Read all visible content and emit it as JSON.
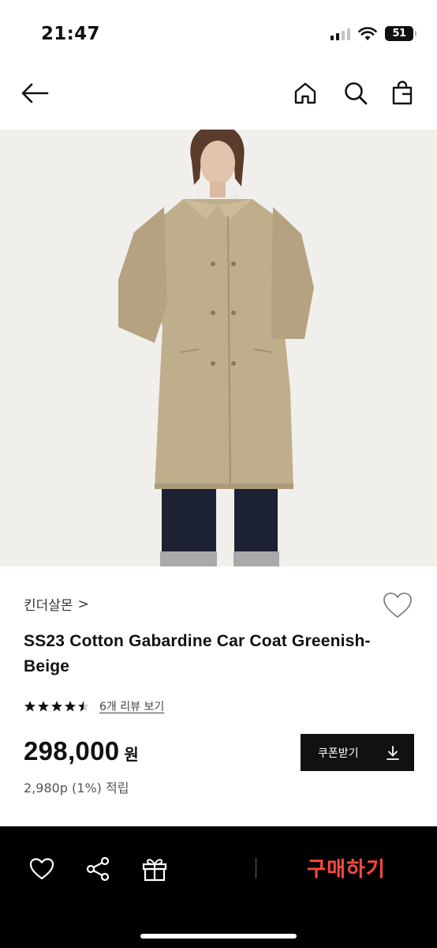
{
  "status_bar": {
    "time": "21:47",
    "battery": "51",
    "icons": [
      "signal-icon",
      "wifi-icon",
      "battery-icon"
    ]
  },
  "nav": {
    "icons": [
      "back-arrow-icon",
      "home-icon",
      "search-icon",
      "shopping-bag-icon"
    ]
  },
  "product": {
    "brand": "킨더살몬",
    "brand_chevron": ">",
    "title": "SS23 Cotton Gabardine Car Coat Greenish-Beige",
    "rating": 4.5,
    "review_link": "6개 리뷰 보기",
    "price": "298,000",
    "currency": "원",
    "points": "2,980p (1%) 적립"
  },
  "coupon": {
    "label": "쿠폰받기",
    "icon": "download-icon"
  },
  "bottom_bar": {
    "icons": [
      "heart-icon",
      "share-icon",
      "gift-icon"
    ],
    "buy_label": "구매하기"
  },
  "colors": {
    "buy_accent": "#ff4a3d",
    "bottom_bar_bg": "#000000",
    "coat": "#bfae8c",
    "background": "#f1efeb"
  }
}
